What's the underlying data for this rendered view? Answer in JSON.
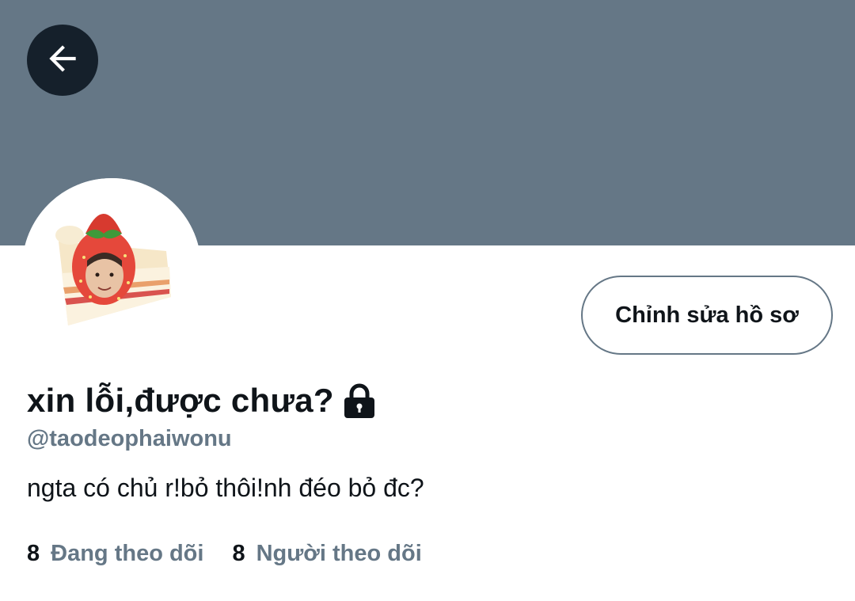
{
  "colors": {
    "banner": "#657786",
    "back_button_bg": "#15202b",
    "primary_text": "#0f1419",
    "secondary_text": "#657786"
  },
  "header": {
    "back_icon": "arrow-left-icon"
  },
  "profile": {
    "avatar_description_icon": "avatar-image",
    "edit_button_label": "Chỉnh sửa hồ sơ",
    "display_name": "xin lỗi,được chưa?",
    "protected_icon": "lock-icon",
    "handle": "@taodeophaiwonu",
    "bio": "ngta có chủ r!bỏ thôi!nh đéo bỏ đc?",
    "following_count": "8",
    "following_label": "Đang theo dõi",
    "followers_count": "8",
    "followers_label": "Người theo dõi"
  }
}
